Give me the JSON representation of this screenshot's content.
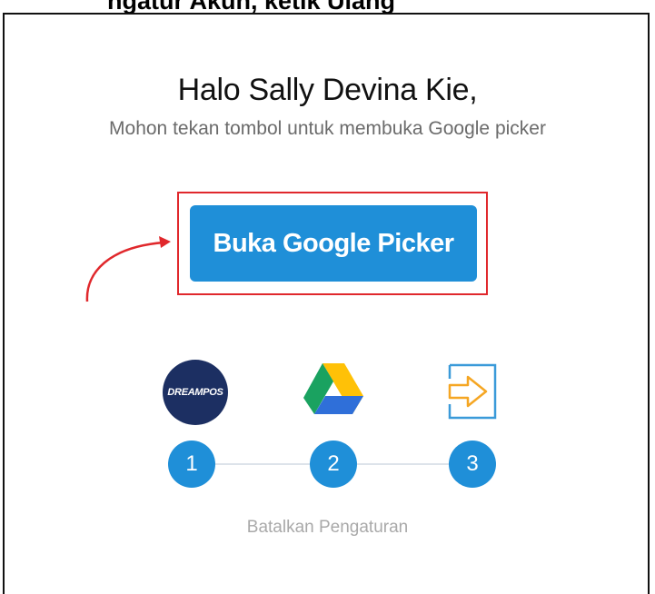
{
  "header": {
    "partial_title": "ngatur Akun, ketik Ulang"
  },
  "main": {
    "greeting": "Halo Sally Devina Kie,",
    "instruction": "Mohon tekan tombol untuk membuka Google picker",
    "picker_button_label": "Buka Google Picker",
    "cancel_label": "Batalkan Pengaturan"
  },
  "steps": [
    {
      "number": "1",
      "icon": "dreampos-logo",
      "logo_text": "DREAMPOS"
    },
    {
      "number": "2",
      "icon": "google-drive-icon"
    },
    {
      "number": "3",
      "icon": "sign-in-arrow-icon"
    }
  ],
  "colors": {
    "accent": "#1f8fd8",
    "highlight": "#e0282c",
    "dreampos_navy": "#1c2f62",
    "muted_text": "#a9a9a9"
  }
}
